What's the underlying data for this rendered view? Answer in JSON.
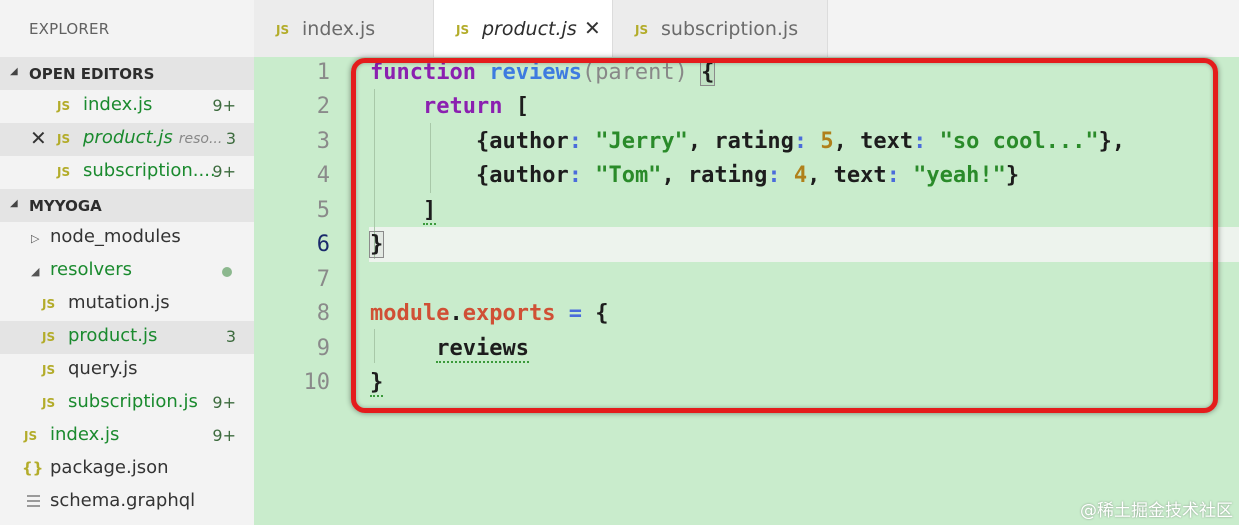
{
  "sidebar": {
    "title": "EXPLORER",
    "open_editors": {
      "label": "OPEN EDITORS",
      "items": [
        {
          "icon": "JS",
          "name": "index.js",
          "badge": "9+"
        },
        {
          "icon": "JS",
          "name": "product.js",
          "desc": "reso...",
          "badge": "3"
        },
        {
          "icon": "JS",
          "name": "subscription....",
          "badge": "9+"
        }
      ]
    },
    "workspace": {
      "label": "MYYOGA",
      "items": [
        {
          "name": "node_modules"
        },
        {
          "name": "resolvers"
        },
        {
          "icon": "JS",
          "name": "mutation.js"
        },
        {
          "icon": "JS",
          "name": "product.js",
          "badge": "3"
        },
        {
          "icon": "JS",
          "name": "query.js"
        },
        {
          "icon": "JS",
          "name": "subscription.js",
          "badge": "9+"
        },
        {
          "icon": "JS",
          "name": "index.js",
          "badge": "9+"
        },
        {
          "icon": "{}",
          "name": "package.json"
        },
        {
          "name": "schema.graphql"
        }
      ]
    }
  },
  "tabs": [
    {
      "icon": "JS",
      "label": "index.js"
    },
    {
      "icon": "JS",
      "label": "product.js",
      "close": "✕"
    },
    {
      "icon": "JS",
      "label": "subscription.js"
    }
  ],
  "editor": {
    "line_numbers": [
      "1",
      "2",
      "3",
      "4",
      "5",
      "6",
      "7",
      "8",
      "9",
      "10"
    ],
    "code": {
      "l1": {
        "kw": "function",
        "fn": "reviews",
        "open": "(",
        "param": "parent",
        "close": ")",
        "brace": "{"
      },
      "l2": {
        "kw": "return",
        "bracket": "["
      },
      "l3": {
        "open": "{",
        "k1": "author",
        "c1": ":",
        "s1": "\"Jerry\"",
        "sep1": ",",
        "k2": "rating",
        "c2": ":",
        "n1": "5",
        "sep2": ",",
        "k3": "text",
        "c3": ":",
        "s2": "\"so cool...\"",
        "close": "},"
      },
      "l4": {
        "open": "{",
        "k1": "author",
        "c1": ":",
        "s1": "\"Tom\"",
        "sep1": ",",
        "k2": "rating",
        "c2": ":",
        "n1": "4",
        "sep2": ",",
        "k3": "text",
        "c3": ":",
        "s2": "\"yeah!\"",
        "close": "}"
      },
      "l5": {
        "bracket": "]"
      },
      "l6": {
        "brace": "}"
      },
      "l8": {
        "mod": "module",
        "dot": ".",
        "exp": "exports",
        "eq": "=",
        "brace": "{"
      },
      "l9": {
        "prop": "reviews"
      },
      "l10": {
        "brace": "}"
      }
    }
  },
  "watermark": "@稀土掘金技术社区",
  "colors": {
    "editor_bg": "#c9eccc",
    "highlight_border": "#e41c1c",
    "js_icon": "#b3ac2a",
    "tree_green": "#1a8a2e"
  }
}
